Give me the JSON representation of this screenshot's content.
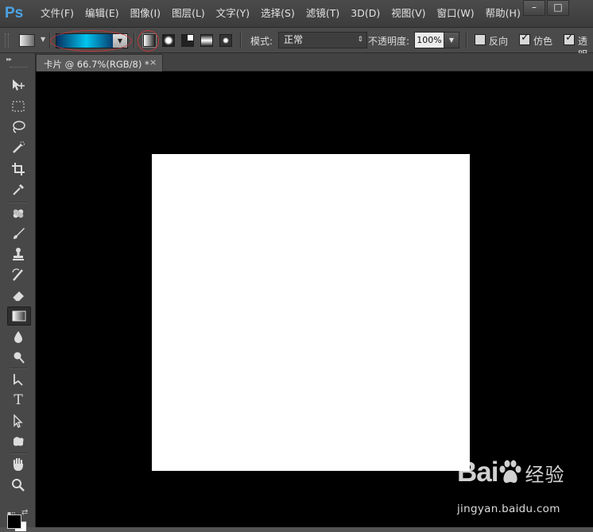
{
  "app": {
    "logo": "Ps"
  },
  "menu": {
    "items": [
      "文件(F)",
      "编辑(E)",
      "图像(I)",
      "图层(L)",
      "文字(Y)",
      "选择(S)",
      "滤镜(T)",
      "3D(D)",
      "视图(V)",
      "窗口(W)",
      "帮助(H)"
    ]
  },
  "window_controls": {
    "minimize": "–",
    "maximize": "□"
  },
  "options_bar": {
    "tool_preset_icon": "gradient-preset-icon",
    "gradient_colors": [
      "#06305e",
      "#00c4f0",
      "#0a3b6b"
    ],
    "gradient_types": [
      "linear",
      "radial",
      "angle",
      "reflected",
      "diamond"
    ],
    "selected_gradient_type": "linear",
    "mode_label": "模式:",
    "mode_value": "正常",
    "opacity_label": "不透明度:",
    "opacity_value": "100%",
    "reverse_label": "反向",
    "reverse_checked": false,
    "dither_label": "仿色",
    "dither_checked": true,
    "transparency_label": "透明",
    "transparency_checked": true,
    "highlight_color": "#c0383a"
  },
  "document_tab": {
    "label": "卡片 @ 66.7%(RGB/8) *",
    "close": "×"
  },
  "toolbar": {
    "tools": [
      "move",
      "marquee",
      "lasso",
      "quick-select",
      "crop",
      "eyedropper",
      "healing",
      "brush",
      "clone-stamp",
      "history-brush",
      "eraser",
      "gradient",
      "blur",
      "dodge",
      "pen",
      "type",
      "path-select",
      "shape",
      "hand",
      "zoom"
    ],
    "active_tool": "gradient",
    "type_glyph": "T"
  },
  "colors": {
    "foreground": "#000000",
    "background": "#ffffff",
    "workspace": "#000000",
    "canvas": "#ffffff"
  },
  "watermark": {
    "brand": "Bai",
    "brand_cn": "经验",
    "url": "jingyan.baidu.com"
  }
}
